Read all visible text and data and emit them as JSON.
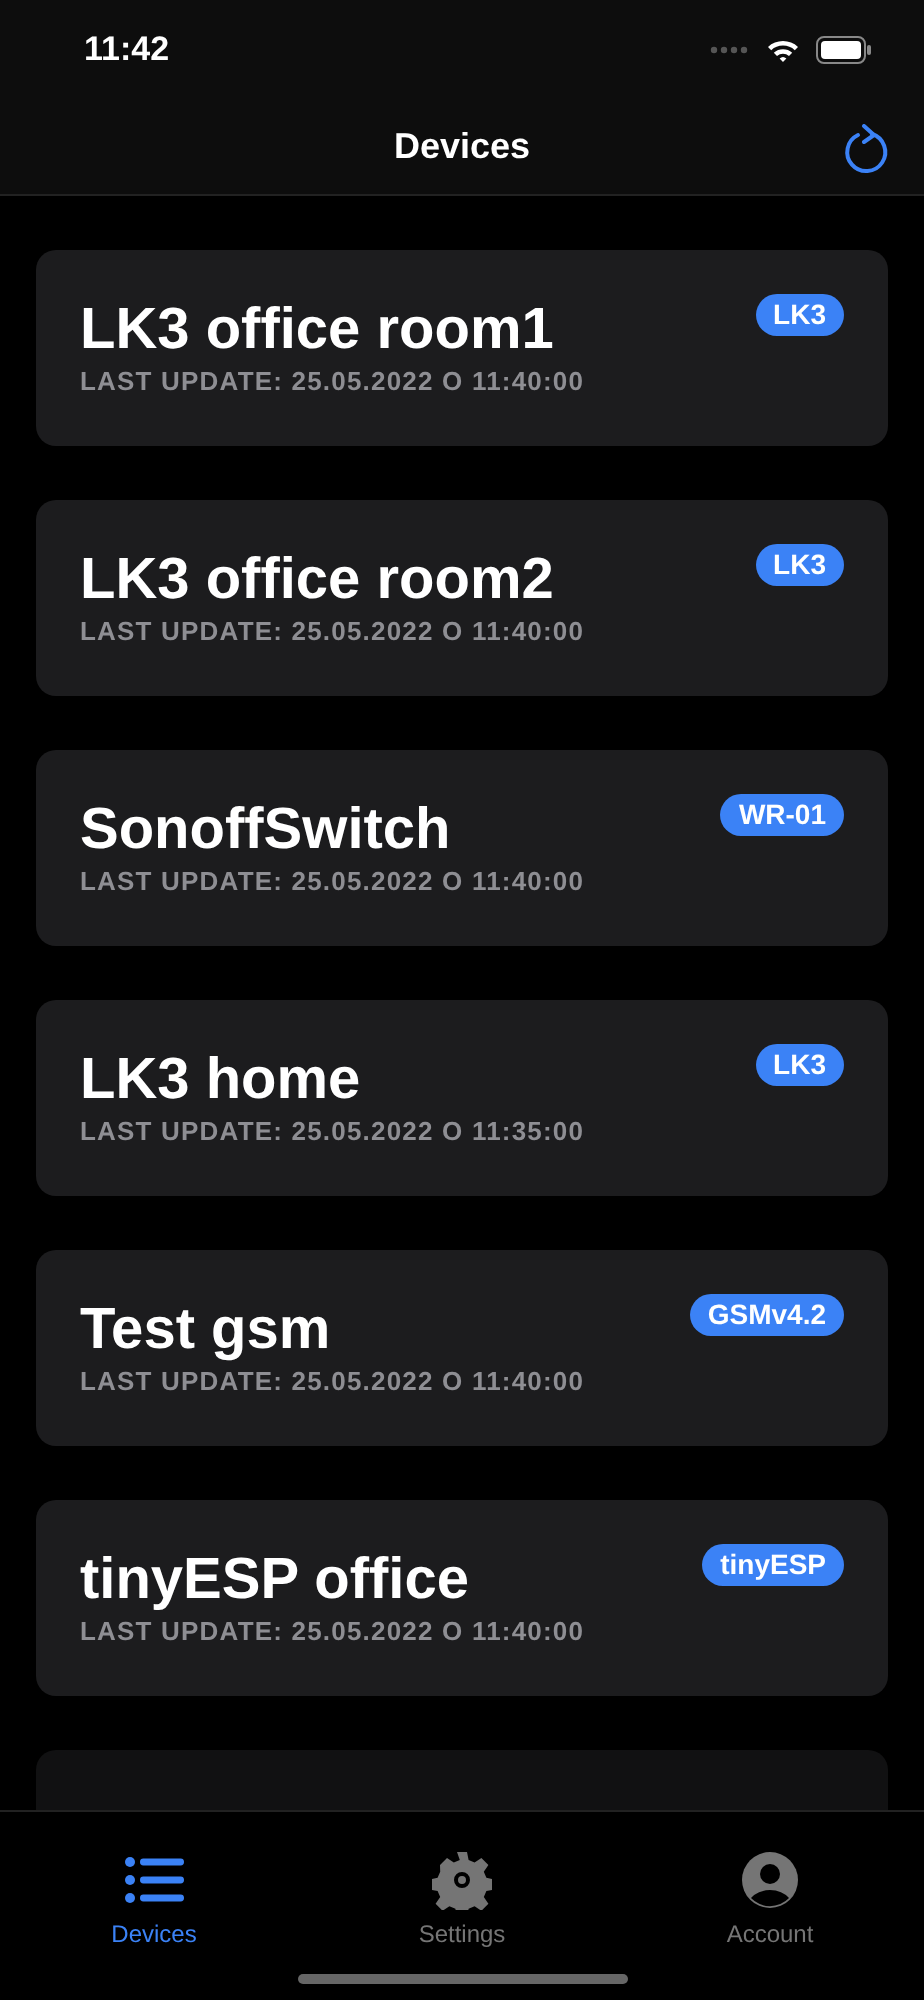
{
  "status_bar": {
    "time": "11:42"
  },
  "nav": {
    "title": "Devices"
  },
  "devices": [
    {
      "name": "LK3 office room1",
      "last_update": "LAST UPDATE: 25.05.2022 O 11:40:00",
      "badge": "LK3"
    },
    {
      "name": "LK3 office room2",
      "last_update": "LAST UPDATE: 25.05.2022 O 11:40:00",
      "badge": "LK3"
    },
    {
      "name": "SonoffSwitch",
      "last_update": "LAST UPDATE: 25.05.2022 O 11:40:00",
      "badge": "WR-01"
    },
    {
      "name": "LK3 home",
      "last_update": "LAST UPDATE: 25.05.2022 O 11:35:00",
      "badge": "LK3"
    },
    {
      "name": "Test gsm",
      "last_update": "LAST UPDATE: 25.05.2022 O 11:40:00",
      "badge": "GSMv4.2"
    },
    {
      "name": "tinyESP office",
      "last_update": "LAST UPDATE: 25.05.2022 O 11:40:00",
      "badge": "tinyESP"
    }
  ],
  "tabs": [
    {
      "label": "Devices",
      "kind": "list",
      "selected": true
    },
    {
      "label": "Settings",
      "kind": "gear",
      "selected": false
    },
    {
      "label": "Account",
      "kind": "person",
      "selected": false
    }
  ]
}
